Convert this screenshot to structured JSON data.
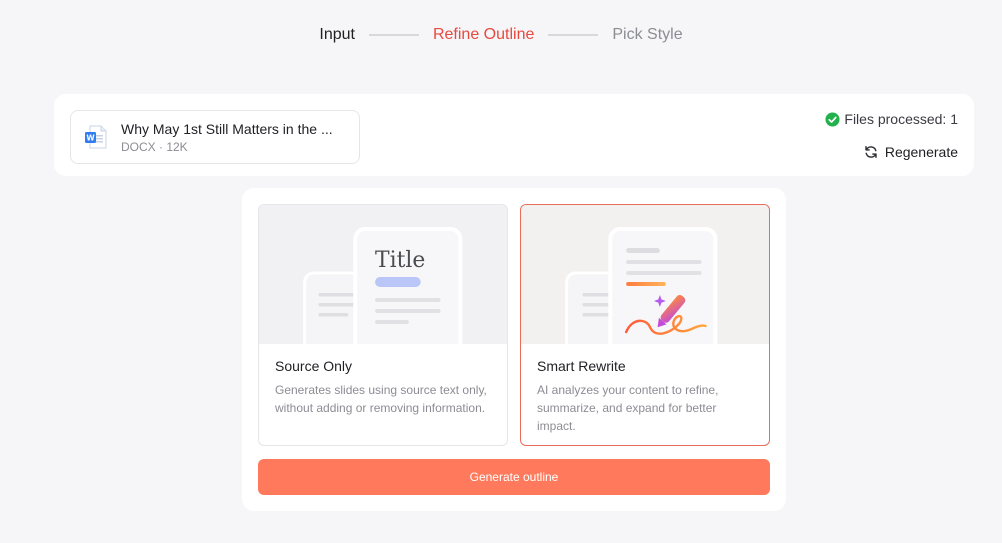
{
  "stepper": {
    "steps": [
      {
        "label": "Input",
        "state": "done"
      },
      {
        "label": "Refine Outline",
        "state": "active"
      },
      {
        "label": "Pick Style",
        "state": "todo"
      }
    ]
  },
  "file": {
    "name": "Why May 1st Still Matters in the ...",
    "meta": "DOCX · 12K",
    "icon": "word-doc-icon"
  },
  "status": {
    "processed_label": "Files processed: 1",
    "regenerate_label": "Regenerate"
  },
  "options": [
    {
      "title": "Source Only",
      "description": "Generates slides using source text only, without adding or removing information.",
      "illustration_text": "Title",
      "selected": false
    },
    {
      "title": "Smart Rewrite",
      "description": "AI analyzes your content to refine, summarize, and expand for better impact.",
      "selected": true
    }
  ],
  "actions": {
    "generate_label": "Generate outline"
  },
  "colors": {
    "accent_red": "#e8493f",
    "button": "#ff7a5c",
    "success": "#22b14c",
    "selected_border": "#ea6c5b"
  }
}
